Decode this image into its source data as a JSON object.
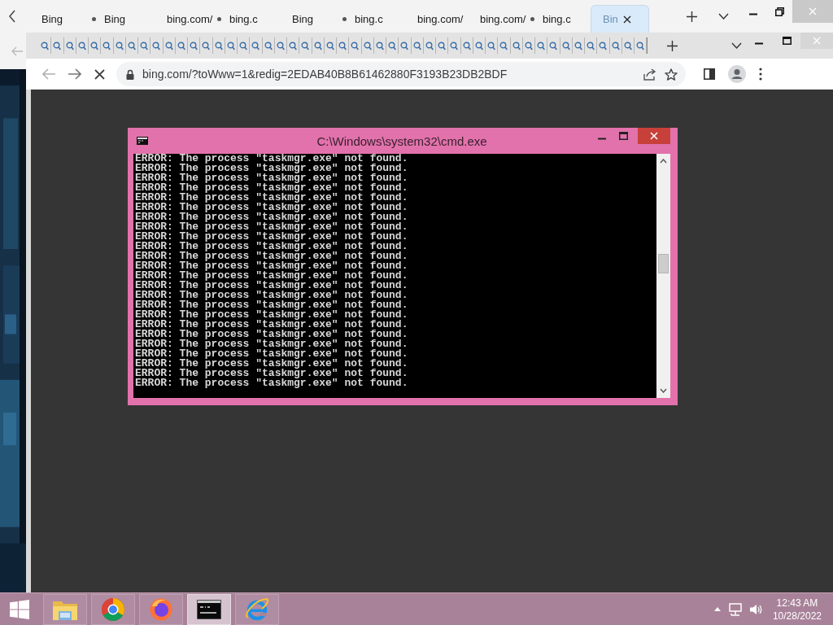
{
  "back_window": {
    "tabs": [
      {
        "label": "Bing",
        "loading": false,
        "selected": false
      },
      {
        "label": "Bing",
        "loading": true,
        "selected": false
      },
      {
        "label": "bing.com/",
        "loading": false,
        "selected": false
      },
      {
        "label": "bing.c",
        "loading": true,
        "selected": false
      },
      {
        "label": "Bing",
        "loading": false,
        "selected": false
      },
      {
        "label": "bing.c",
        "loading": true,
        "selected": false
      },
      {
        "label": "bing.com/",
        "loading": false,
        "selected": false
      },
      {
        "label": "bing.com/",
        "loading": false,
        "selected": false
      },
      {
        "label": "bing.c",
        "loading": true,
        "selected": false
      },
      {
        "label": "Bin",
        "loading": false,
        "selected": true
      }
    ]
  },
  "browser": {
    "tabs": [
      {
        "selected": false
      },
      {
        "selected": false
      },
      {
        "selected": false
      },
      {
        "selected": false
      },
      {
        "selected": false
      },
      {
        "selected": false
      },
      {
        "selected": false
      },
      {
        "selected": false
      },
      {
        "selected": false
      },
      {
        "selected": false
      },
      {
        "selected": false
      },
      {
        "selected": false
      },
      {
        "selected": false
      },
      {
        "selected": false
      },
      {
        "selected": false
      },
      {
        "selected": false
      },
      {
        "selected": false
      },
      {
        "selected": false
      },
      {
        "selected": false
      },
      {
        "selected": false
      },
      {
        "selected": false
      },
      {
        "selected": false
      },
      {
        "selected": false
      },
      {
        "selected": false
      },
      {
        "selected": false
      },
      {
        "selected": false
      },
      {
        "selected": false
      },
      {
        "selected": false
      },
      {
        "selected": false
      },
      {
        "selected": false
      },
      {
        "selected": false
      },
      {
        "selected": false
      },
      {
        "selected": false
      },
      {
        "selected": false
      },
      {
        "selected": false
      },
      {
        "selected": false
      },
      {
        "selected": false
      },
      {
        "selected": false
      },
      {
        "selected": false
      },
      {
        "selected": false
      },
      {
        "selected": false
      },
      {
        "selected": false
      },
      {
        "selected": false
      },
      {
        "selected": false
      },
      {
        "selected": false
      },
      {
        "selected": false
      },
      {
        "selected": false
      },
      {
        "selected": false
      },
      {
        "selected": false
      }
    ],
    "loading": true,
    "address": "bing.com/?toWww=1&redig=2EDAB40B8B61462880F3193B23DB2BDF"
  },
  "console": {
    "title": "C:\\Windows\\system32\\cmd.exe",
    "lines": [
      "ERROR: The process \"taskmgr.exe\" not found.",
      "ERROR: The process \"taskmgr.exe\" not found.",
      "ERROR: The process \"taskmgr.exe\" not found.",
      "ERROR: The process \"taskmgr.exe\" not found.",
      "ERROR: The process \"taskmgr.exe\" not found.",
      "ERROR: The process \"taskmgr.exe\" not found.",
      "ERROR: The process \"taskmgr.exe\" not found.",
      "ERROR: The process \"taskmgr.exe\" not found.",
      "ERROR: The process \"taskmgr.exe\" not found.",
      "ERROR: The process \"taskmgr.exe\" not found.",
      "ERROR: The process \"taskmgr.exe\" not found.",
      "ERROR: The process \"taskmgr.exe\" not found.",
      "ERROR: The process \"taskmgr.exe\" not found.",
      "ERROR: The process \"taskmgr.exe\" not found.",
      "ERROR: The process \"taskmgr.exe\" not found.",
      "ERROR: The process \"taskmgr.exe\" not found.",
      "ERROR: The process \"taskmgr.exe\" not found.",
      "ERROR: The process \"taskmgr.exe\" not found.",
      "ERROR: The process \"taskmgr.exe\" not found.",
      "ERROR: The process \"taskmgr.exe\" not found.",
      "ERROR: The process \"taskmgr.exe\" not found.",
      "ERROR: The process \"taskmgr.exe\" not found.",
      "ERROR: The process \"taskmgr.exe\" not found.",
      "ERROR: The process \"taskmgr.exe\" not found."
    ]
  },
  "taskbar": {
    "apps": [
      {
        "kind": "files",
        "selected": false
      },
      {
        "kind": "chrome",
        "selected": false
      },
      {
        "kind": "firefox",
        "selected": false
      },
      {
        "kind": "console",
        "selected": true
      },
      {
        "kind": "ie",
        "selected": false
      }
    ],
    "time": "12:43 AM",
    "date": "10/28/2022"
  }
}
